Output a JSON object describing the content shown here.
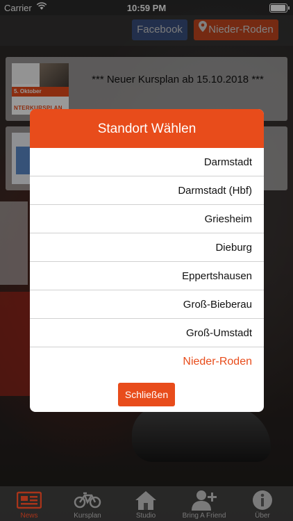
{
  "status_bar": {
    "carrier": "Carrier",
    "time": "10:59 PM"
  },
  "navbar": {
    "facebook_label": "Facebook",
    "location_label": "Nieder-Roden"
  },
  "cards": [
    {
      "text": "*** Neuer Kursplan ab 15.10.2018 ***",
      "thumb_line1": "5. Oktober",
      "thumb_line2": "NTERKURSPLAN"
    },
    {
      "text": ""
    }
  ],
  "modal": {
    "title": "Standort Wählen",
    "options": [
      "Darmstadt",
      "Darmstadt (Hbf)",
      "Griesheim",
      "Dieburg",
      "Eppertshausen",
      "Groß-Bieberau",
      "Groß-Umstadt",
      "Nieder-Roden"
    ],
    "selected_option": "Nieder-Roden",
    "close_label": "Schließen"
  },
  "tabbar": {
    "tabs": [
      {
        "label": "News",
        "icon": "newspaper-icon",
        "active": true
      },
      {
        "label": "Kursplan",
        "icon": "bicycle-icon",
        "active": false
      },
      {
        "label": "Studio",
        "icon": "home-icon",
        "active": false
      },
      {
        "label": "Bring A Friend",
        "icon": "add-person-icon",
        "active": false
      },
      {
        "label": "Über",
        "icon": "info-icon",
        "active": false
      }
    ]
  },
  "colors": {
    "accent": "#e84c1b",
    "facebook": "#3b5998",
    "active_tab": "#a8341a",
    "inactive_tab": "#7a7a7a"
  }
}
